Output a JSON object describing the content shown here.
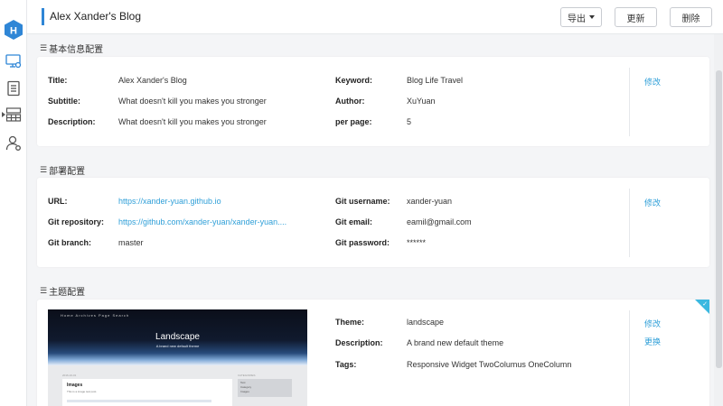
{
  "header": {
    "title": "Alex Xander's Blog",
    "export_label": "导出",
    "refresh_label": "更新",
    "delete_label": "删除"
  },
  "sidebar": {
    "logo_letter": "H",
    "items": [
      {
        "icon": "monitor-settings-icon",
        "active": true
      },
      {
        "icon": "document-list-icon",
        "active": false
      },
      {
        "icon": "table-grid-icon",
        "active": false
      },
      {
        "icon": "user-settings-icon",
        "active": false
      }
    ]
  },
  "sections": {
    "basic": {
      "label": "基本信息配置",
      "fields": {
        "title_label": "Title:",
        "title_value": "Alex Xander's Blog",
        "subtitle_label": "Subtitle:",
        "subtitle_value": "What doesn't kill you makes you stronger",
        "description_label": "Description:",
        "description_value": "What doesn't kill you makes you stronger",
        "keyword_label": "Keyword:",
        "keyword_value": "Blog Life Travel",
        "author_label": "Author:",
        "author_value": "XuYuan",
        "perpage_label": "per page:",
        "perpage_value": "5"
      },
      "edit_label": "修改"
    },
    "deploy": {
      "label": "部署配置",
      "fields": {
        "url_label": "URL:",
        "url_value": "https://xander-yuan.github.io",
        "repo_label": "Git repository:",
        "repo_value": "https://github.com/xander-yuan/xander-yuan....",
        "branch_label": "Git branch:",
        "branch_value": "master",
        "username_label": "Git username:",
        "username_value": "xander-yuan",
        "email_label": "Git email:",
        "email_value": "eamil@gmail.com",
        "password_label": "Git password:",
        "password_value": "******"
      },
      "edit_label": "修改"
    },
    "theme": {
      "label": "主题配置",
      "fields": {
        "theme_label": "Theme:",
        "theme_value": "landscape",
        "description_label": "Description:",
        "description_value": "A brand new default theme",
        "tags_label": "Tags:",
        "tags_value": "Responsive Widget TwoColumus OneColumn"
      },
      "edit_label": "修改",
      "change_label": "更换",
      "preview": {
        "nav": "Home  Archives  Page  Search",
        "title": "Landscape",
        "subtitle": "A brand new default theme",
        "date": "2016-10-01",
        "post_title": "Images",
        "post_text": "This is a image test post.",
        "side_label": "CATEGORIES",
        "side_items": [
          "Test",
          "Category",
          "Images"
        ]
      }
    }
  },
  "colors": {
    "accent": "#2f86d6",
    "link": "#2f9fd8",
    "corner": "#3bb8e0"
  }
}
